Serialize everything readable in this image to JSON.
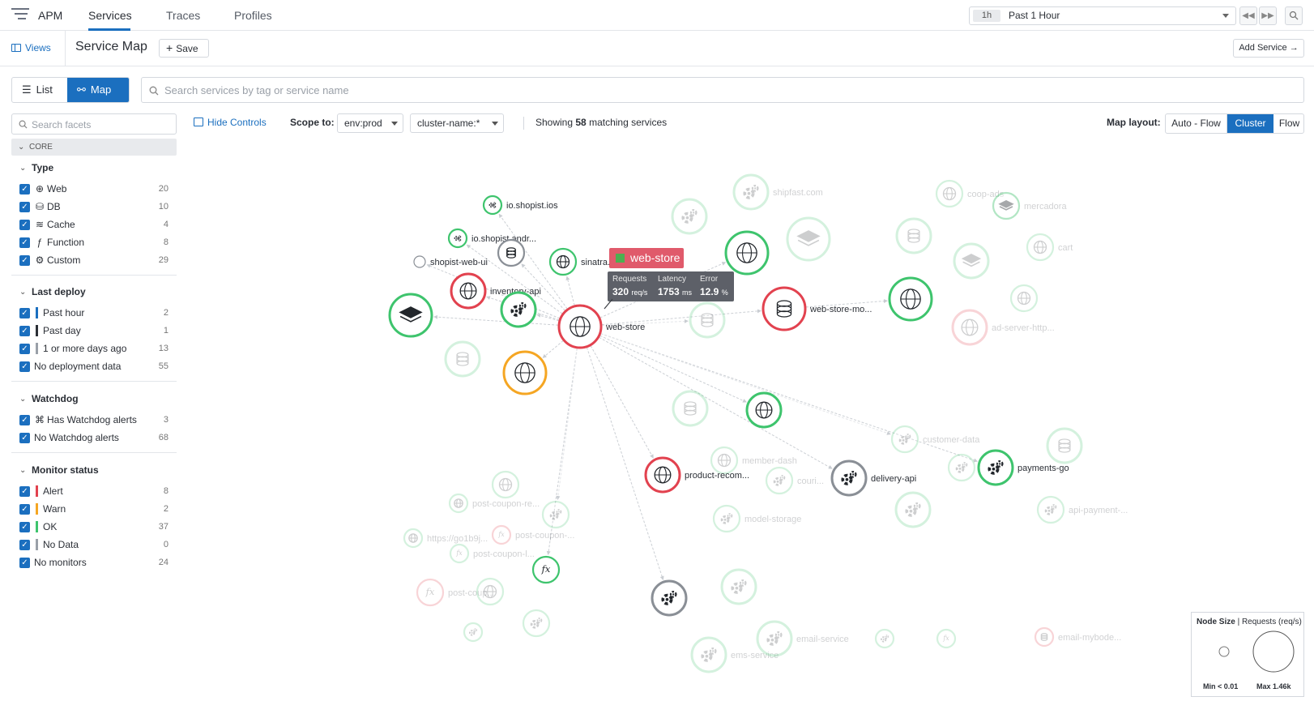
{
  "topbar": {
    "app": "APM",
    "tabs": [
      {
        "label": "Services",
        "active": true
      },
      {
        "label": "Traces",
        "active": false
      },
      {
        "label": "Profiles",
        "active": false
      }
    ],
    "time_badge": "1h",
    "time_label": "Past 1 Hour"
  },
  "subbar": {
    "views_label": "Views",
    "title": "Service Map",
    "save_label": "Save",
    "add_service_label": "Add Service"
  },
  "view_toggle": {
    "list_label": "List",
    "map_label": "Map",
    "active": "Map"
  },
  "search": {
    "placeholder": "Search services by tag or service name"
  },
  "facets": {
    "search_placeholder": "Search facets",
    "core_label": "CORE",
    "sections": [
      {
        "title": "Type",
        "items": [
          {
            "label": "Web",
            "count": "20",
            "icon": "globe-icon"
          },
          {
            "label": "DB",
            "count": "10",
            "icon": "database-icon"
          },
          {
            "label": "Cache",
            "count": "4",
            "icon": "layers-icon"
          },
          {
            "label": "Function",
            "count": "8",
            "icon": "function-icon"
          },
          {
            "label": "Custom",
            "count": "29",
            "icon": "gears-icon"
          }
        ]
      },
      {
        "title": "Last deploy",
        "items": [
          {
            "label": "Past hour",
            "count": "2",
            "bar_color": "#1b6fbf"
          },
          {
            "label": "Past day",
            "count": "1",
            "bar_color": "#2b2f36"
          },
          {
            "label": "1 or more days ago",
            "count": "13",
            "bar_color": "#9aa0a8"
          },
          {
            "label": "No deployment data",
            "count": "55"
          }
        ]
      },
      {
        "title": "Watchdog",
        "items": [
          {
            "label": "Has Watchdog alerts",
            "count": "3",
            "icon": "binoculars-icon"
          },
          {
            "label": "No Watchdog alerts",
            "count": "68"
          }
        ]
      },
      {
        "title": "Monitor status",
        "items": [
          {
            "label": "Alert",
            "count": "8",
            "bar_color": "#e2424f"
          },
          {
            "label": "Warn",
            "count": "2",
            "bar_color": "#f5a623"
          },
          {
            "label": "OK",
            "count": "37",
            "bar_color": "#3ec46d"
          },
          {
            "label": "No Data",
            "count": "0",
            "bar_color": "#9aa0a8"
          },
          {
            "label": "No monitors",
            "count": "24"
          }
        ]
      }
    ]
  },
  "controls": {
    "hide_label": "Hide Controls",
    "scope_label": "Scope to:",
    "env_value": "env:prod",
    "cluster_value": "cluster-name:*",
    "showing_prefix": "Showing",
    "showing_count": "58",
    "showing_suffix": "matching services",
    "layout_label": "Map layout:",
    "layout_options": [
      "Auto - Flow",
      "Cluster",
      "Flow"
    ],
    "layout_active": "Cluster"
  },
  "tooltip": {
    "service": "web-store",
    "requests_label": "Requests",
    "requests_value": "320",
    "requests_unit": "req/s",
    "latency_label": "Latency",
    "latency_value": "1753",
    "latency_unit": "ms",
    "error_label": "Error",
    "error_value": "12.9",
    "error_unit": "%"
  },
  "legend": {
    "title_bold": "Node Size",
    "title_rest": "Requests (req/s)",
    "min_label": "Min < 0.01",
    "max_label": "Max 1.46k"
  },
  "colors": {
    "accent": "#1b6fbf",
    "alert": "#e2424f",
    "warn": "#f5a623",
    "ok": "#3ec46d",
    "nodata": "#8a8f96"
  },
  "map": {
    "nodes": [
      {
        "id": "io-shopist-ios",
        "label": "io.shopist.ios",
        "icon": "mobile",
        "status": "ok",
        "size": "xs",
        "faded": false
      },
      {
        "id": "io-shopist-andr",
        "label": "io.shopist.andr...",
        "icon": "mobile",
        "status": "ok",
        "size": "xs",
        "faded": false
      },
      {
        "id": "shopist-web-ui",
        "label": "shopist-web-ui",
        "icon": "none",
        "status": "nodata",
        "size": "xxs",
        "faded": false
      },
      {
        "id": "db-top",
        "label": "",
        "icon": "db",
        "status": "nodata",
        "size": "s",
        "faded": false
      },
      {
        "id": "sinatra",
        "label": "sinatra...",
        "icon": "web",
        "status": "ok",
        "size": "s",
        "faded": false
      },
      {
        "id": "inventory-api",
        "label": "inventory-api",
        "icon": "web",
        "status": "alert",
        "size": "m",
        "faded": false
      },
      {
        "id": "cache-left",
        "label": "",
        "icon": "cache",
        "status": "ok",
        "size": "l",
        "faded": false
      },
      {
        "id": "custom-inv",
        "label": "",
        "icon": "custom",
        "status": "ok",
        "size": "m",
        "faded": false
      },
      {
        "id": "web-store",
        "label": "web-store",
        "icon": "web",
        "status": "alert",
        "size": "l",
        "faded": false
      },
      {
        "id": "web-warn",
        "label": "",
        "icon": "web",
        "status": "warn",
        "size": "l",
        "faded": false
      },
      {
        "id": "web-top",
        "label": "",
        "icon": "web",
        "status": "ok",
        "size": "l",
        "faded": false
      },
      {
        "id": "web-store-mo",
        "label": "web-store-mo...",
        "icon": "db",
        "status": "alert",
        "size": "l",
        "faded": false
      },
      {
        "id": "web-right",
        "label": "",
        "icon": "web",
        "status": "ok",
        "size": "l",
        "faded": false
      },
      {
        "id": "web-mid",
        "label": "",
        "icon": "web",
        "status": "ok",
        "size": "m",
        "faded": false
      },
      {
        "id": "product-recom",
        "label": "product-recom...",
        "icon": "web",
        "status": "alert",
        "size": "m",
        "faded": false
      },
      {
        "id": "delivery-api",
        "label": "delivery-api",
        "icon": "custom",
        "status": "nodata",
        "size": "m",
        "faded": false
      },
      {
        "id": "payments-go",
        "label": "payments-go",
        "icon": "custom",
        "status": "ok",
        "size": "m",
        "faded": false
      },
      {
        "id": "fn-low",
        "label": "",
        "icon": "fn",
        "status": "ok",
        "size": "s",
        "faded": false
      },
      {
        "id": "custom-low",
        "label": "",
        "icon": "custom",
        "status": "nodata",
        "size": "m",
        "faded": false
      },
      {
        "id": "f1",
        "label": "shipfast.com",
        "icon": "custom",
        "status": "ok",
        "size": "m",
        "faded": true
      },
      {
        "id": "f2",
        "label": "",
        "icon": "custom",
        "status": "ok",
        "size": "m",
        "faded": true
      },
      {
        "id": "f3",
        "label": "",
        "icon": "cache",
        "status": "ok",
        "size": "l",
        "faded": true
      },
      {
        "id": "f4",
        "label": "coop-ads",
        "icon": "web",
        "status": "ok",
        "size": "s",
        "faded": true
      },
      {
        "id": "f5",
        "label": "",
        "icon": "cache",
        "status": "ok",
        "size": "s",
        "faded": true
      },
      {
        "id": "f6",
        "label": "mercadora",
        "icon": "cache",
        "status": "ok",
        "size": "s",
        "faded": true
      },
      {
        "id": "f7",
        "label": "",
        "icon": "db",
        "status": "ok",
        "size": "m",
        "faded": true
      },
      {
        "id": "f8",
        "label": "cart",
        "icon": "web",
        "status": "ok",
        "size": "s",
        "faded": true
      },
      {
        "id": "f9",
        "label": "",
        "icon": "cache",
        "status": "ok",
        "size": "m",
        "faded": true
      },
      {
        "id": "f10",
        "label": "",
        "icon": "web",
        "status": "ok",
        "size": "s",
        "faded": true
      },
      {
        "id": "f11",
        "label": "ad-server-http...",
        "icon": "web",
        "status": "alert",
        "size": "m",
        "faded": true
      },
      {
        "id": "f12",
        "label": "",
        "icon": "db",
        "status": "ok",
        "size": "m",
        "faded": true
      },
      {
        "id": "f13",
        "label": "",
        "icon": "db",
        "status": "ok",
        "size": "m",
        "faded": true
      },
      {
        "id": "f14",
        "label": "",
        "icon": "db",
        "status": "ok",
        "size": "m",
        "faded": true
      },
      {
        "id": "f15",
        "label": "member-dash",
        "icon": "web",
        "status": "ok",
        "size": "s",
        "faded": true
      },
      {
        "id": "f16",
        "label": "couri...",
        "icon": "custom",
        "status": "ok",
        "size": "s",
        "faded": true
      },
      {
        "id": "f17",
        "label": "customer-data",
        "icon": "custom",
        "status": "ok",
        "size": "s",
        "faded": true
      },
      {
        "id": "f18",
        "label": "",
        "icon": "custom",
        "status": "ok",
        "size": "s",
        "faded": true
      },
      {
        "id": "f19",
        "label": "",
        "icon": "db",
        "status": "ok",
        "size": "m",
        "faded": true
      },
      {
        "id": "f20",
        "label": "",
        "icon": "web",
        "status": "ok",
        "size": "s",
        "faded": true
      },
      {
        "id": "f21",
        "label": "post-coupon-re...",
        "icon": "web",
        "status": "ok",
        "size": "xs",
        "faded": true
      },
      {
        "id": "f22",
        "label": "",
        "icon": "custom",
        "status": "ok",
        "size": "s",
        "faded": true
      },
      {
        "id": "f23",
        "label": "model-storage",
        "icon": "custom",
        "status": "ok",
        "size": "s",
        "faded": true
      },
      {
        "id": "f24",
        "label": "",
        "icon": "custom",
        "status": "ok",
        "size": "m",
        "faded": true
      },
      {
        "id": "f25",
        "label": "api-payment-...",
        "icon": "custom",
        "status": "ok",
        "size": "s",
        "faded": true
      },
      {
        "id": "f26",
        "label": "https://go1b9j...",
        "icon": "web",
        "status": "ok",
        "size": "xs",
        "faded": true
      },
      {
        "id": "f27",
        "label": "post-coupon-...",
        "icon": "fn",
        "status": "alert",
        "size": "xs",
        "faded": true
      },
      {
        "id": "f28",
        "label": "post-coupon-l...",
        "icon": "fn",
        "status": "ok",
        "size": "xs",
        "faded": true
      },
      {
        "id": "f29",
        "label": "post-coup...",
        "icon": "fn",
        "status": "alert",
        "size": "s",
        "faded": true
      },
      {
        "id": "f30",
        "label": "",
        "icon": "web",
        "status": "ok",
        "size": "s",
        "faded": true
      },
      {
        "id": "f31",
        "label": "",
        "icon": "custom",
        "status": "ok",
        "size": "m",
        "faded": true
      },
      {
        "id": "f32",
        "label": "",
        "icon": "custom",
        "status": "ok",
        "size": "xs",
        "faded": true
      },
      {
        "id": "f33",
        "label": "",
        "icon": "custom",
        "status": "ok",
        "size": "s",
        "faded": true
      },
      {
        "id": "f34",
        "label": "ems-service",
        "icon": "custom",
        "status": "ok",
        "size": "m",
        "faded": true
      },
      {
        "id": "f35",
        "label": "email-service",
        "icon": "custom",
        "status": "ok",
        "size": "m",
        "faded": true
      },
      {
        "id": "f36",
        "label": "",
        "icon": "custom",
        "status": "ok",
        "size": "xs",
        "faded": true
      },
      {
        "id": "f37",
        "label": "",
        "icon": "fn",
        "status": "ok",
        "size": "xs",
        "faded": true
      },
      {
        "id": "f38",
        "label": "email-mybode...",
        "icon": "db",
        "status": "alert",
        "size": "xs",
        "faded": true
      }
    ],
    "edges": [
      [
        "web-store",
        "io-shopist-ios"
      ],
      [
        "web-store",
        "io-shopist-andr"
      ],
      [
        "web-store",
        "shopist-web-ui"
      ],
      [
        "web-store",
        "db-top"
      ],
      [
        "web-store",
        "sinatra"
      ],
      [
        "web-store",
        "inventory-api"
      ],
      [
        "web-store",
        "cache-left"
      ],
      [
        "web-store",
        "custom-inv"
      ],
      [
        "web-store",
        "web-warn"
      ],
      [
        "web-store",
        "web-top"
      ],
      [
        "web-store",
        "web-store-mo"
      ],
      [
        "web-store",
        "web-mid"
      ],
      [
        "web-store",
        "product-recom"
      ],
      [
        "web-store",
        "delivery-api"
      ],
      [
        "web-store",
        "payments-go"
      ],
      [
        "web-store",
        "fn-low"
      ],
      [
        "web-store",
        "custom-low"
      ],
      [
        "web-store-mo",
        "web-right"
      ],
      [
        "web-store",
        "f12"
      ],
      [
        "web-store",
        "f17"
      ],
      [
        "web-store",
        "f22"
      ]
    ]
  }
}
